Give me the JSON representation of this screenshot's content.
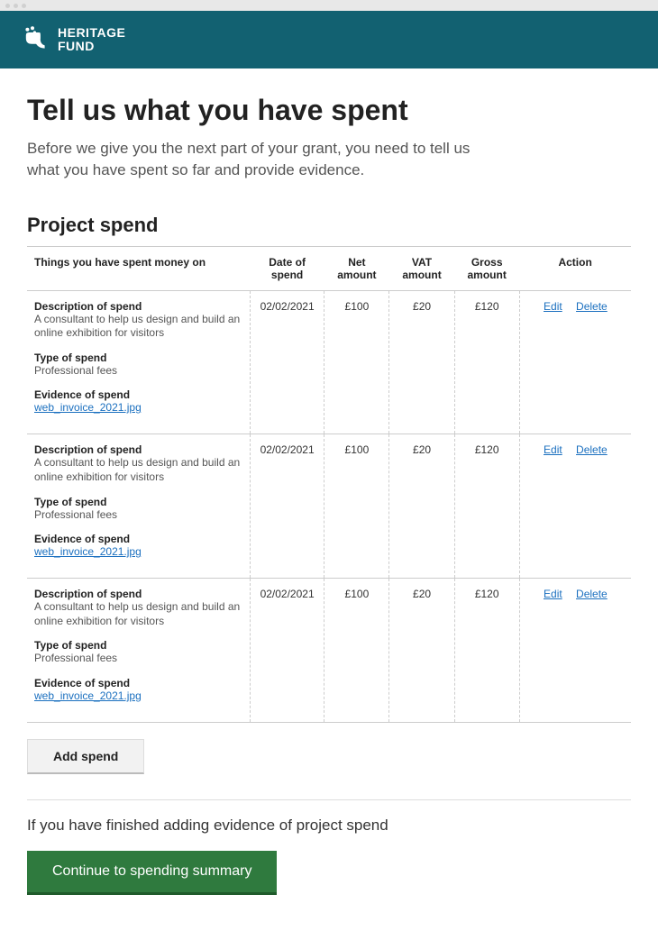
{
  "brand": {
    "line1": "HERITAGE",
    "line2": "FUND"
  },
  "page": {
    "title": "Tell us what you have spent",
    "intro": "Before we give you the next part of your grant, you need to tell us what you have spent so far and provide evidence.",
    "section_heading": "Project spend",
    "finish_text": "If you have finished adding evidence of project spend",
    "add_button": "Add spend",
    "continue_button": "Continue to spending summary"
  },
  "table": {
    "headers": {
      "things": "Things you have spent money on",
      "date": "Date of spend",
      "net": "Net amount",
      "vat": "VAT amount",
      "gross": "Gross amount",
      "action": "Action"
    },
    "labels": {
      "description": "Description of spend",
      "type": "Type of spend",
      "evidence": "Evidence of spend",
      "edit": "Edit",
      "delete": "Delete"
    },
    "rows": [
      {
        "description": "A consultant to help us design and build an online exhibition for visitors",
        "type": "Professional fees",
        "evidence_file": "web_invoice_2021.jpg",
        "date": "02/02/2021",
        "net": "£100",
        "vat": "£20",
        "gross": "£120"
      },
      {
        "description": "A consultant to help us design and build an online exhibition for visitors",
        "type": "Professional fees",
        "evidence_file": "web_invoice_2021.jpg",
        "date": "02/02/2021",
        "net": "£100",
        "vat": "£20",
        "gross": "£120"
      },
      {
        "description": "A consultant to help us design and build an online exhibition for visitors",
        "type": "Professional fees",
        "evidence_file": "web_invoice_2021.jpg",
        "date": "02/02/2021",
        "net": "£100",
        "vat": "£20",
        "gross": "£120"
      }
    ]
  }
}
